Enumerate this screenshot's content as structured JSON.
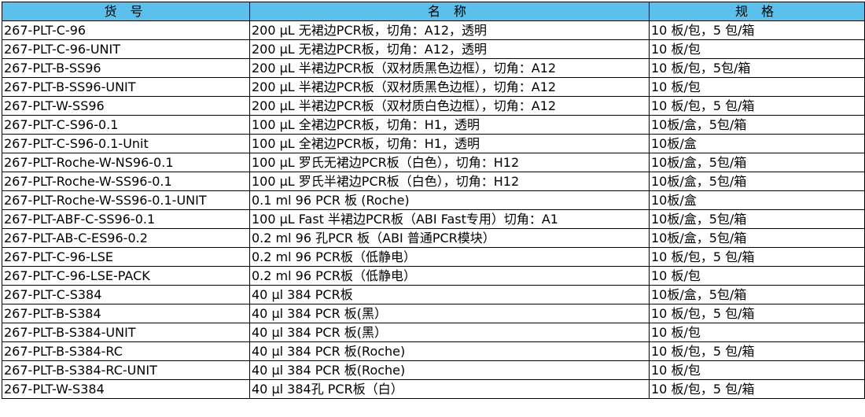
{
  "header": {
    "code": "货 号",
    "name": "名 称",
    "spec": "规 格"
  },
  "header_bg": "#5bc0eb",
  "rows": [
    {
      "code": "267-PLT-C-96",
      "name": "200 µL 无裙边PCR板，切角：A12，透明",
      "spec": "10 板/包，5 包/箱"
    },
    {
      "code": "267-PLT-C-96-UNIT",
      "name": "200 µL 无裙边PCR板，切角：A12，透明",
      "spec": "10 板/包"
    },
    {
      "code": "267-PLT-B-SS96",
      "name": "200 µL 半裙边PCR板（双材质黑色边框），切角：A12",
      "spec": "10 板/包，5包/箱"
    },
    {
      "code": "267-PLT-B-SS96-UNIT",
      "name": "200 µL 半裙边PCR板（双材质黑色边框），切角：A12",
      "spec": "10 板/包"
    },
    {
      "code": "267-PLT-W-SS96",
      "name": "200 µL 半裙边PCR板（双材质白色边框），切角：A12",
      "spec": "10 板/包，5 包/箱"
    },
    {
      "code": "267-PLT-C-S96-0.1",
      "name": "100 µL 全裙边PCR板，切角：H1，透明",
      "spec": "10板/盒，5包/箱"
    },
    {
      "code": "267-PLT-C-S96-0.1-Unit",
      "name": "100 µL 全裙边PCR板，切角：H1，透明",
      "spec": "10板/盒"
    },
    {
      "code": "267-PLT-Roche-W-NS96-0.1",
      "name": "100 µL 罗氏无裙边PCR板（白色），切角：H12",
      "spec": "10板/盒，5包/箱"
    },
    {
      "code": "267-PLT-Roche-W-SS96-0.1",
      "name": "100 µL 罗氏半裙边PCR板（白色），切角：H12",
      "spec": "10板/盒，5包/箱"
    },
    {
      "code": "267-PLT-Roche-W-SS96-0.1-UNIT",
      "name": "0.1 ml 96 PCR 板 (Roche)",
      "spec": "10板/盒"
    },
    {
      "code": "267-PLT-ABF-C-SS96-0.1",
      "name": " 100 µL Fast 半裙边PCR板（ABI Fast专用）切角：A1",
      "spec": "10板/盒，5包/箱"
    },
    {
      "code": "267-PLT-AB-C-ES96-0.2",
      "name": "0.2 ml 96 孔PCR 板（ABI 普通PCR模块）",
      "spec": "10板/盒，5包/箱"
    },
    {
      "code": "267-PLT-C-96-LSE",
      "name": "0.2 ml 96 PCR板（低静电）",
      "spec": "10 板/包，5 包/箱"
    },
    {
      "code": "267-PLT-C-96-LSE-PACK",
      "name": "0.2 ml 96 PCR板（低静电）",
      "spec": "10 板/包"
    },
    {
      "code": "267-PLT-C-S384",
      "name": "40 µl 384 PCR板",
      "spec": "10板/盒，5包/箱"
    },
    {
      "code": "267-PLT-B-S384",
      "name": "40 µl 384 PCR 板(黑）",
      "spec": "10 板/包，5 包/箱"
    },
    {
      "code": "267-PLT-B-S384-UNIT",
      "name": "40 µl 384 PCR 板(黑）",
      "spec": "10 板/包"
    },
    {
      "code": "267-PLT-B-S384-RC",
      "name": "40 µl 384 PCR 板(Roche)",
      "spec": "10 板/包，5 包/箱"
    },
    {
      "code": "267-PLT-B-S384-RC-UNIT",
      "name": "40 µl 384 PCR 板(Roche)",
      "spec": "10 板/包"
    },
    {
      "code": "267-PLT-W-S384",
      "name": "40 µl 384孔 PCR板（白）",
      "spec": "10 板/包，5 包/箱"
    }
  ]
}
